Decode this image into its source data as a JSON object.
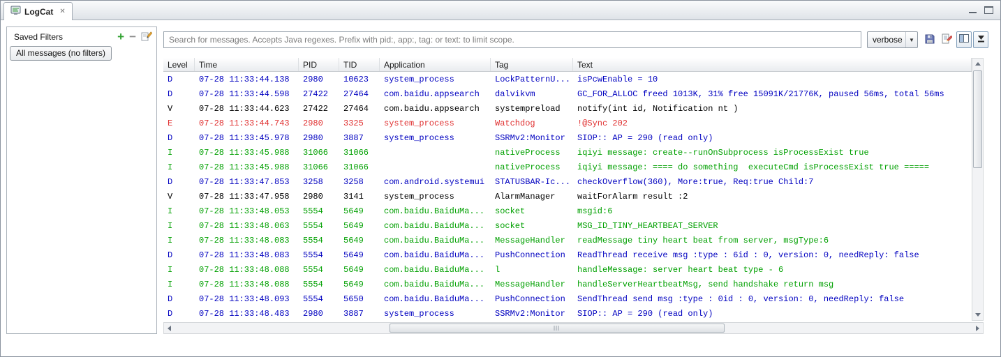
{
  "tab": {
    "title": "LogCat"
  },
  "glyphs": {
    "add": "+",
    "remove": "−",
    "close": "✕",
    "dropdown": "▼"
  },
  "filters": {
    "header": "Saved Filters",
    "items": [
      {
        "label": "All messages (no filters)"
      }
    ]
  },
  "toolbar": {
    "search_placeholder": "Search for messages. Accepts Java regexes. Prefix with pid:, app:, tag: or text: to limit scope.",
    "level_selected": "verbose"
  },
  "table": {
    "columns": [
      "Level",
      "Time",
      "PID",
      "TID",
      "Application",
      "Tag",
      "Text"
    ],
    "column_keys": [
      "level",
      "time",
      "pid",
      "tid",
      "app",
      "tag",
      "text"
    ],
    "level_colors": {
      "V": "#000000",
      "D": "#0000c0",
      "I": "#00a000",
      "E": "#e03131"
    },
    "rows": [
      {
        "level": "D",
        "time": "07-28 11:33:44.138",
        "pid": "2980",
        "tid": "10623",
        "app": "system_process",
        "tag": "LockPatternU...",
        "text": "isPcwEnable = 10"
      },
      {
        "level": "D",
        "time": "07-28 11:33:44.598",
        "pid": "27422",
        "tid": "27464",
        "app": "com.baidu.appsearch",
        "tag": "dalvikvm",
        "text": "GC_FOR_ALLOC freed 1013K, 31% free 15091K/21776K, paused 56ms, total 56ms"
      },
      {
        "level": "V",
        "time": "07-28 11:33:44.623",
        "pid": "27422",
        "tid": "27464",
        "app": "com.baidu.appsearch",
        "tag": "systempreload",
        "text": "notify(int id, Notification nt )"
      },
      {
        "level": "E",
        "time": "07-28 11:33:44.743",
        "pid": "2980",
        "tid": "3325",
        "app": "system_process",
        "tag": "Watchdog",
        "text": "!@Sync 202"
      },
      {
        "level": "D",
        "time": "07-28 11:33:45.978",
        "pid": "2980",
        "tid": "3887",
        "app": "system_process",
        "tag": "SSRMv2:Monitor",
        "text": "SIOP:: AP = 290 (read only)"
      },
      {
        "level": "I",
        "time": "07-28 11:33:45.988",
        "pid": "31066",
        "tid": "31066",
        "app": "",
        "tag": "nativeProcess",
        "text": "iqiyi message: create--runOnSubprocess isProcessExist true"
      },
      {
        "level": "I",
        "time": "07-28 11:33:45.988",
        "pid": "31066",
        "tid": "31066",
        "app": "",
        "tag": "nativeProcess",
        "text": "iqiyi message: ==== do something  executeCmd isProcessExist true ====="
      },
      {
        "level": "D",
        "time": "07-28 11:33:47.853",
        "pid": "3258",
        "tid": "3258",
        "app": "com.android.systemui",
        "tag": "STATUSBAR-Ic...",
        "text": "checkOverflow(360), More:true, Req:true Child:7"
      },
      {
        "level": "V",
        "time": "07-28 11:33:47.958",
        "pid": "2980",
        "tid": "3141",
        "app": "system_process",
        "tag": "AlarmManager",
        "text": "waitForAlarm result :2"
      },
      {
        "level": "I",
        "time": "07-28 11:33:48.053",
        "pid": "5554",
        "tid": "5649",
        "app": "com.baidu.BaiduMa...",
        "tag": "socket",
        "text": "msgid:6"
      },
      {
        "level": "I",
        "time": "07-28 11:33:48.063",
        "pid": "5554",
        "tid": "5649",
        "app": "com.baidu.BaiduMa...",
        "tag": "socket",
        "text": "MSG_ID_TINY_HEARTBEAT_SERVER"
      },
      {
        "level": "I",
        "time": "07-28 11:33:48.083",
        "pid": "5554",
        "tid": "5649",
        "app": "com.baidu.BaiduMa...",
        "tag": "MessageHandler",
        "text": "readMessage tiny heart beat from server, msgType:6"
      },
      {
        "level": "D",
        "time": "07-28 11:33:48.083",
        "pid": "5554",
        "tid": "5649",
        "app": "com.baidu.BaiduMa...",
        "tag": "PushConnection",
        "text": "ReadThread receive msg :type : 6id : 0, version: 0, needReply: false"
      },
      {
        "level": "I",
        "time": "07-28 11:33:48.088",
        "pid": "5554",
        "tid": "5649",
        "app": "com.baidu.BaiduMa...",
        "tag": "l",
        "text": "handleMessage: server heart beat type - 6"
      },
      {
        "level": "I",
        "time": "07-28 11:33:48.088",
        "pid": "5554",
        "tid": "5649",
        "app": "com.baidu.BaiduMa...",
        "tag": "MessageHandler",
        "text": "handleServerHeartbeatMsg, send handshake return msg"
      },
      {
        "level": "D",
        "time": "07-28 11:33:48.093",
        "pid": "5554",
        "tid": "5650",
        "app": "com.baidu.BaiduMa...",
        "tag": "PushConnection",
        "text": "SendThread send msg :type : 0id : 0, version: 0, needReply: false"
      },
      {
        "level": "D",
        "time": "07-28 11:33:48.483",
        "pid": "2980",
        "tid": "3887",
        "app": "system_process",
        "tag": "SSRMv2:Monitor",
        "text": "SIOP:: AP = 290 (read only)"
      }
    ]
  }
}
